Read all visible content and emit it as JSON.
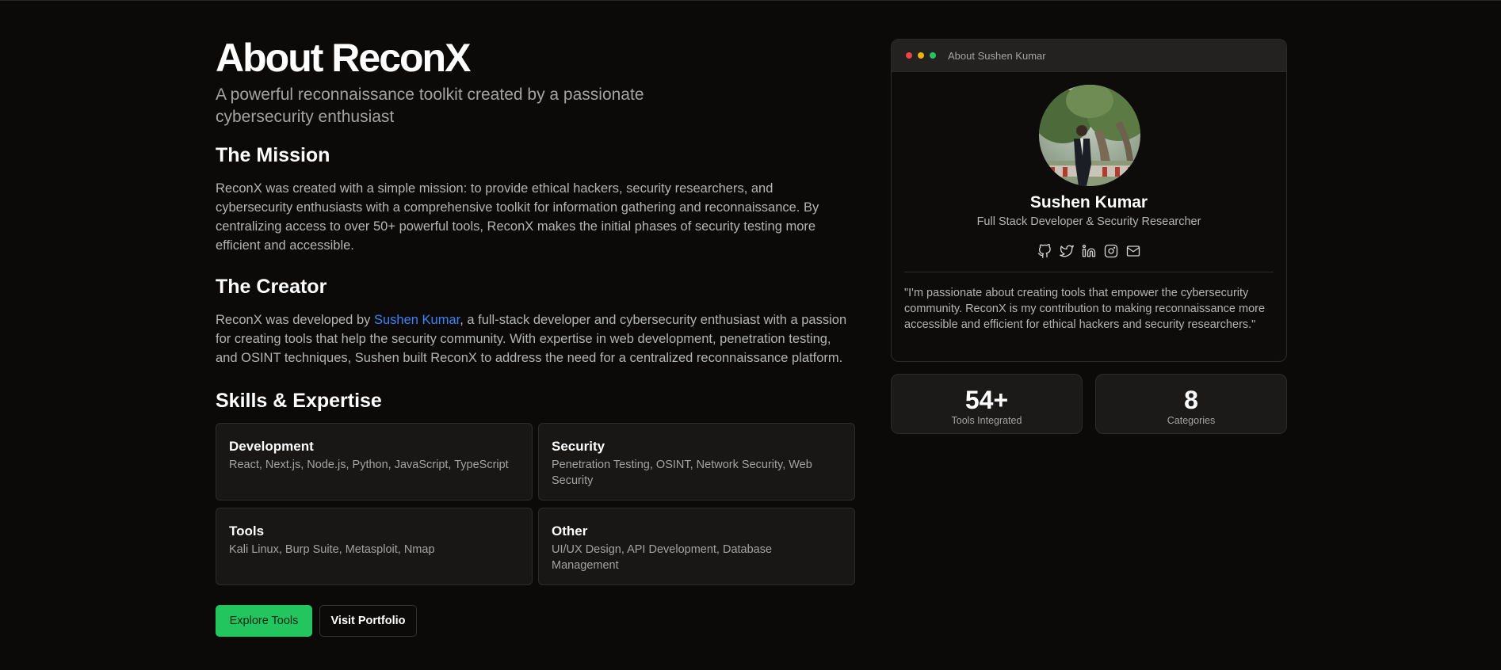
{
  "hero": {
    "title": "About ReconX",
    "subtitle": "A powerful reconnaissance toolkit created by a passionate cybersecurity enthusiast"
  },
  "mission": {
    "heading": "The Mission",
    "text": "ReconX was created with a simple mission: to provide ethical hackers, security researchers, and cybersecurity enthusiasts with a comprehensive toolkit for information gathering and reconnaissance. By centralizing access to over 50+ powerful tools, ReconX makes the initial phases of security testing more efficient and accessible."
  },
  "creator": {
    "heading": "The Creator",
    "text_before": "ReconX was developed by ",
    "link_text": "Sushen Kumar",
    "text_after": ", a full-stack developer and cybersecurity enthusiast with a passion for creating tools that help the security community. With expertise in web development, penetration testing, and OSINT techniques, Sushen built ReconX to address the need for a centralized reconnaissance platform."
  },
  "skills": {
    "heading": "Skills & Expertise",
    "items": [
      {
        "title": "Development",
        "desc": "React, Next.js, Node.js, Python, JavaScript, TypeScript"
      },
      {
        "title": "Security",
        "desc": "Penetration Testing, OSINT, Network Security, Web Security"
      },
      {
        "title": "Tools",
        "desc": "Kali Linux, Burp Suite, Metasploit, Nmap"
      },
      {
        "title": "Other",
        "desc": "UI/UX Design, API Development, Database Management"
      }
    ]
  },
  "buttons": {
    "primary": "Explore Tools",
    "secondary": "Visit Portfolio"
  },
  "profile_card": {
    "window_title": "About Sushen Kumar",
    "name": "Sushen Kumar",
    "role": "Full Stack Developer & Security Researcher",
    "social_icons": [
      "github-icon",
      "twitter-icon",
      "linkedin-icon",
      "instagram-icon",
      "mail-icon"
    ],
    "quote": "\"I'm passionate about creating tools that empower the cybersecurity community. ReconX is my contribution to making reconnaissance more accessible and efficient for ethical hackers and security researchers.\""
  },
  "stats": [
    {
      "value": "54+",
      "label": "Tools Integrated"
    },
    {
      "value": "8",
      "label": "Categories"
    }
  ],
  "colors": {
    "accent": "#22c55e",
    "link": "#3b82f6",
    "background": "#0b0a09"
  }
}
